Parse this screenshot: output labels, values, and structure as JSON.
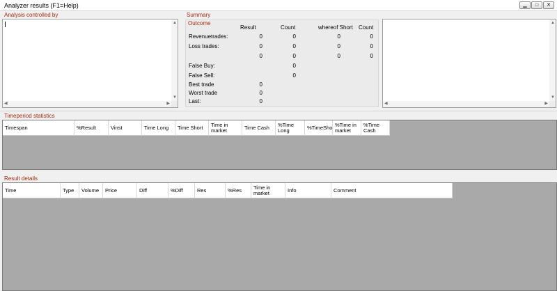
{
  "window": {
    "title": "Analyzer results (F1=Help)",
    "controls": [
      "minimize-icon",
      "maximize-icon",
      "close-icon"
    ]
  },
  "analysis": {
    "label": "Analysis controlled by"
  },
  "summary": {
    "label": "Summary",
    "outcome_label": "Outcome",
    "headers": {
      "result": "Result",
      "count": "Count",
      "whereof_short": "whereof Short",
      "count2": "Count"
    },
    "rows": [
      {
        "label": "Revenuetrades:",
        "result": "0",
        "count": "0",
        "short": "0",
        "count2": "0"
      },
      {
        "label": "Loss trades:",
        "result": "0",
        "count": "0",
        "short": "0",
        "count2": "0"
      },
      {
        "label": "",
        "result": "0",
        "count": "0",
        "short": "0",
        "count2": "0"
      }
    ],
    "false_buy": {
      "label": "False Buy:",
      "count": "0"
    },
    "false_sell": {
      "label": "False Sell:",
      "count": "0"
    },
    "best_trade": {
      "label": "Best trade",
      "result": "0"
    },
    "worst_trade": {
      "label": "Worst trade",
      "result": "0"
    },
    "last": {
      "label": "Last:",
      "result": "0"
    }
  },
  "timeperiod": {
    "label": "Timeperiod statistics",
    "columns": [
      "Timespan",
      "%Result",
      "Vinst",
      "Time Long",
      "Time Short",
      "Time in market",
      "Time Cash",
      "%Time Long",
      "%TimeShor",
      "%Time in market",
      "%Time Cash"
    ]
  },
  "details": {
    "label": "Result details",
    "columns": [
      "Time",
      "Type",
      "Volume",
      "Price",
      "Diff",
      "%Diff",
      "Res",
      "%Res",
      "Time in market",
      "Info",
      "Comment"
    ]
  },
  "colors": {
    "label_red": "#a02a10",
    "grid_bg": "#a9a9a9",
    "window_bg": "#f0f0f0"
  }
}
